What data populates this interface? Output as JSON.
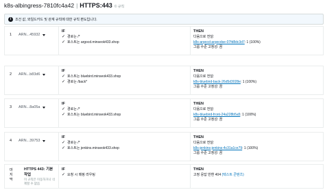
{
  "header": {
    "name": "k8s-albingress-7810fc4a42",
    "separator": "|",
    "protocol": "HTTPS:443",
    "subtitle": "© 규칙"
  },
  "info": {
    "icon": "info-icon",
    "text": "조건 값, 와일드카드 및 관계 규칙에 대한 규칙 편도입니다."
  },
  "rules": [
    {
      "num": "1",
      "arn": "ARN...45932",
      "if_label": "IF",
      "conditions": [
        "경로는 /*",
        "호스트는 argocd.minseok433.shop"
      ],
      "then_label": "THEN",
      "forward_label": "다음으로 전달:",
      "target": "k8s-argocd-argocdse-07fd8dc3d7",
      "weight": ": 1 (100%)",
      "stickiness": "그룹 수준 고정성: 끔"
    },
    {
      "num": "2",
      "arn": "ARN...b83d6",
      "if_label": "IF",
      "conditions": [
        "호스트는 bluebird.minseok433.shop",
        "경로는 /back*"
      ],
      "then_label": "THEN",
      "forward_label": "다음으로 전달:",
      "target": "k8s-bluebird-back-26d5d3028e",
      "weight": ": 1 (100%)",
      "stickiness": "그룹 수준 고정성: 끔"
    },
    {
      "num": "3",
      "arn": "ARN...8a05a",
      "if_label": "IF",
      "conditions": [
        "경로는 /*",
        "호스트는 bluebird.minseok433.shop"
      ],
      "then_label": "THEN",
      "forward_label": "다음으로 전달:",
      "target": "k8s-bluebird-front-24a228b5a5",
      "weight": ": 1 (100%)",
      "stickiness": "그룹 수준 고정성: 끔"
    },
    {
      "num": "4",
      "arn": "ARN...39753",
      "if_label": "IF",
      "conditions": [
        "경로는 /*",
        "호스트는 jenkins.minseok433.shop"
      ],
      "then_label": "THEN",
      "forward_label": "다음으로 전달:",
      "target": "k8s-jenkins-jenkins-4c31a1ce79",
      "weight": ": 1 (100%)",
      "stickiness": "그룹 수준 고정성: 끔"
    }
  ],
  "default_rule": {
    "left_lines": [
      "마",
      "지",
      "막"
    ],
    "title": "HTTPS 443: 기본 작업",
    "note": "이 규칙은 이동하거나 삭제할 수 없음",
    "if_label": "IF",
    "condition": "요청 시 매핑 라우팅",
    "then_label": "THEN",
    "action": "고정 응답 반환 404",
    "action_link": "(텍스트 콘텐츠)"
  }
}
